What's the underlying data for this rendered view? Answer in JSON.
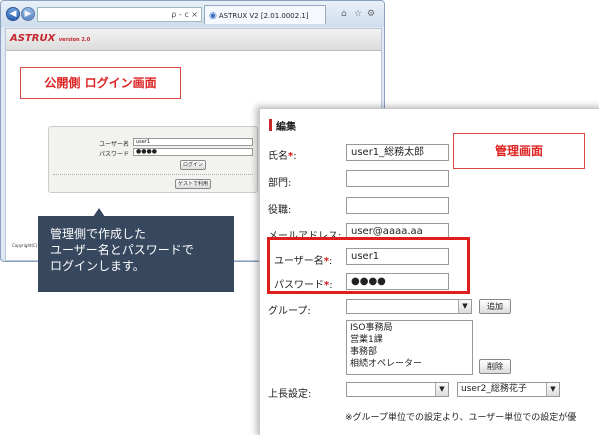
{
  "browser": {
    "address_suffix": "ρ - c ×",
    "tab_title": "ASTRUX V2 [2.01.0002.1]",
    "logo_main": "ASTRUX",
    "logo_version": "version 2.0",
    "copyright": "Copyright(C)"
  },
  "public_label": "公開側 ログイン画面",
  "login": {
    "username_label": "ユーザー名",
    "username_value": "user1",
    "password_label": "パスワード",
    "password_value": "●●●●",
    "login_button": "ログイン",
    "guest_button": "ゲストで利用"
  },
  "tooltip": {
    "line1": "管理側で作成した",
    "line2": "ユーザー名とパスワードで",
    "line3": "ログインします。"
  },
  "admin": {
    "section_title": "編集",
    "admin_label": "管理画面",
    "fields": {
      "name_label": "氏名",
      "name_value": "user1_総務太郎",
      "dept_label": "部門:",
      "title_label": "役職:",
      "email_label": "メールアドレス:",
      "email_value": "user@aaaa.aa",
      "username_label": "ユーザー名",
      "username_value": "user1",
      "password_label": "パスワード",
      "password_value": "●●●●",
      "group_label": "グループ:",
      "boss_label": "上長設定:"
    },
    "required_mark": "*",
    "colon": ":",
    "add_button": "追加",
    "delete_button": "削除",
    "group_list": [
      "ISO事務局",
      "営業1課",
      "事務部",
      "相続オペレーター"
    ],
    "boss_select_value": "user2_総務花子",
    "note": "※グループ単位での設定より、ユーザー単位での設定が優"
  },
  "colors": {
    "accent_red": "#d22",
    "tooltip_bg": "#36475e"
  }
}
